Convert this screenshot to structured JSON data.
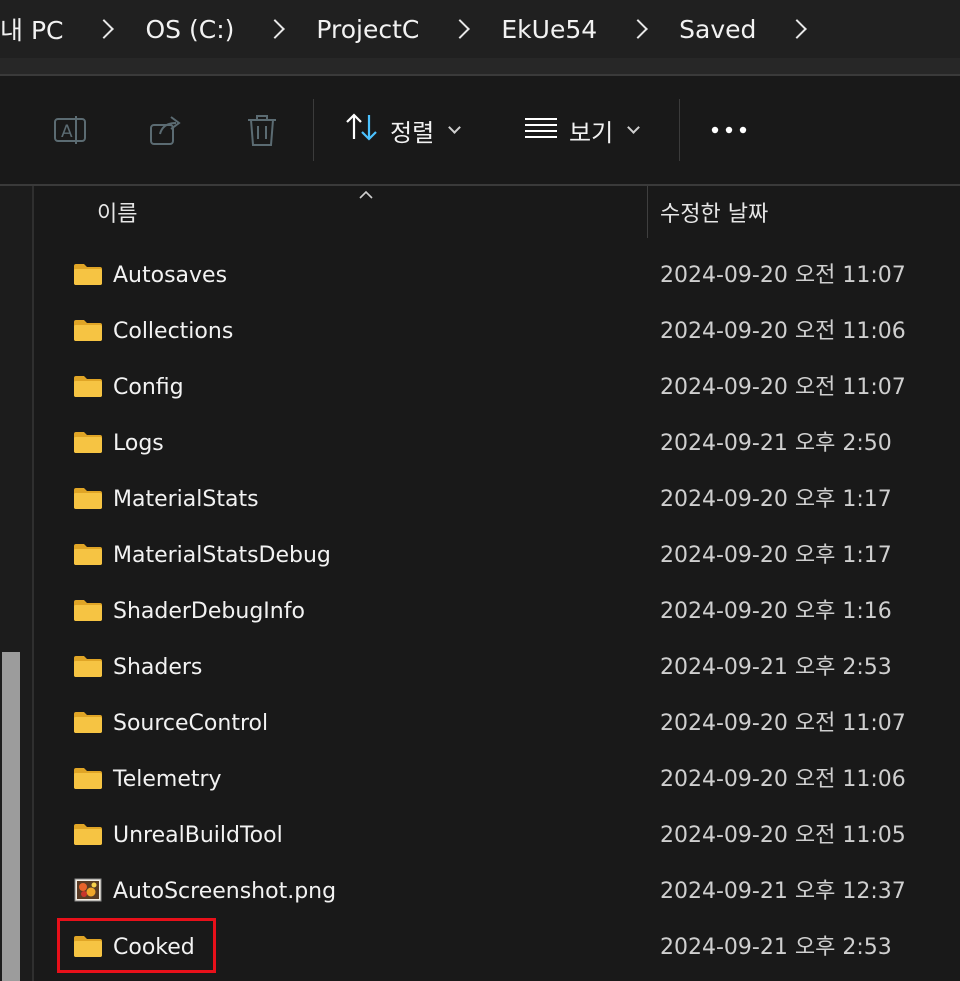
{
  "breadcrumb": [
    "내 PC",
    "OS (C:)",
    "ProjectC",
    "EkUe54",
    "Saved"
  ],
  "command_bar": {
    "rename_icon": "rename-icon",
    "share_icon": "share-icon",
    "delete_icon": "trash-icon",
    "sort_label": "정렬",
    "view_label": "보기",
    "more_icon": "more-icon"
  },
  "columns": {
    "name": "이름",
    "date_modified": "수정한 날짜"
  },
  "files": [
    {
      "name": "Autosaves",
      "date": "2024-09-20 오전 11:07",
      "type": "folder"
    },
    {
      "name": "Collections",
      "date": "2024-09-20 오전 11:06",
      "type": "folder"
    },
    {
      "name": "Config",
      "date": "2024-09-20 오전 11:07",
      "type": "folder"
    },
    {
      "name": "Logs",
      "date": "2024-09-21 오후 2:50",
      "type": "folder"
    },
    {
      "name": "MaterialStats",
      "date": "2024-09-20 오후 1:17",
      "type": "folder"
    },
    {
      "name": "MaterialStatsDebug",
      "date": "2024-09-20 오후 1:17",
      "type": "folder"
    },
    {
      "name": "ShaderDebugInfo",
      "date": "2024-09-20 오후 1:16",
      "type": "folder"
    },
    {
      "name": "Shaders",
      "date": "2024-09-21 오후 2:53",
      "type": "folder"
    },
    {
      "name": "SourceControl",
      "date": "2024-09-20 오전 11:07",
      "type": "folder"
    },
    {
      "name": "Telemetry",
      "date": "2024-09-20 오전 11:06",
      "type": "folder"
    },
    {
      "name": "UnrealBuildTool",
      "date": "2024-09-20 오전 11:05",
      "type": "folder"
    },
    {
      "name": "AutoScreenshot.png",
      "date": "2024-09-21 오후 12:37",
      "type": "image"
    },
    {
      "name": "Cooked",
      "date": "2024-09-21 오후 2:53",
      "type": "folder"
    }
  ],
  "colors": {
    "highlight": "#e8101a",
    "folder": "#f6c443",
    "accent": "#4cc2ff"
  }
}
